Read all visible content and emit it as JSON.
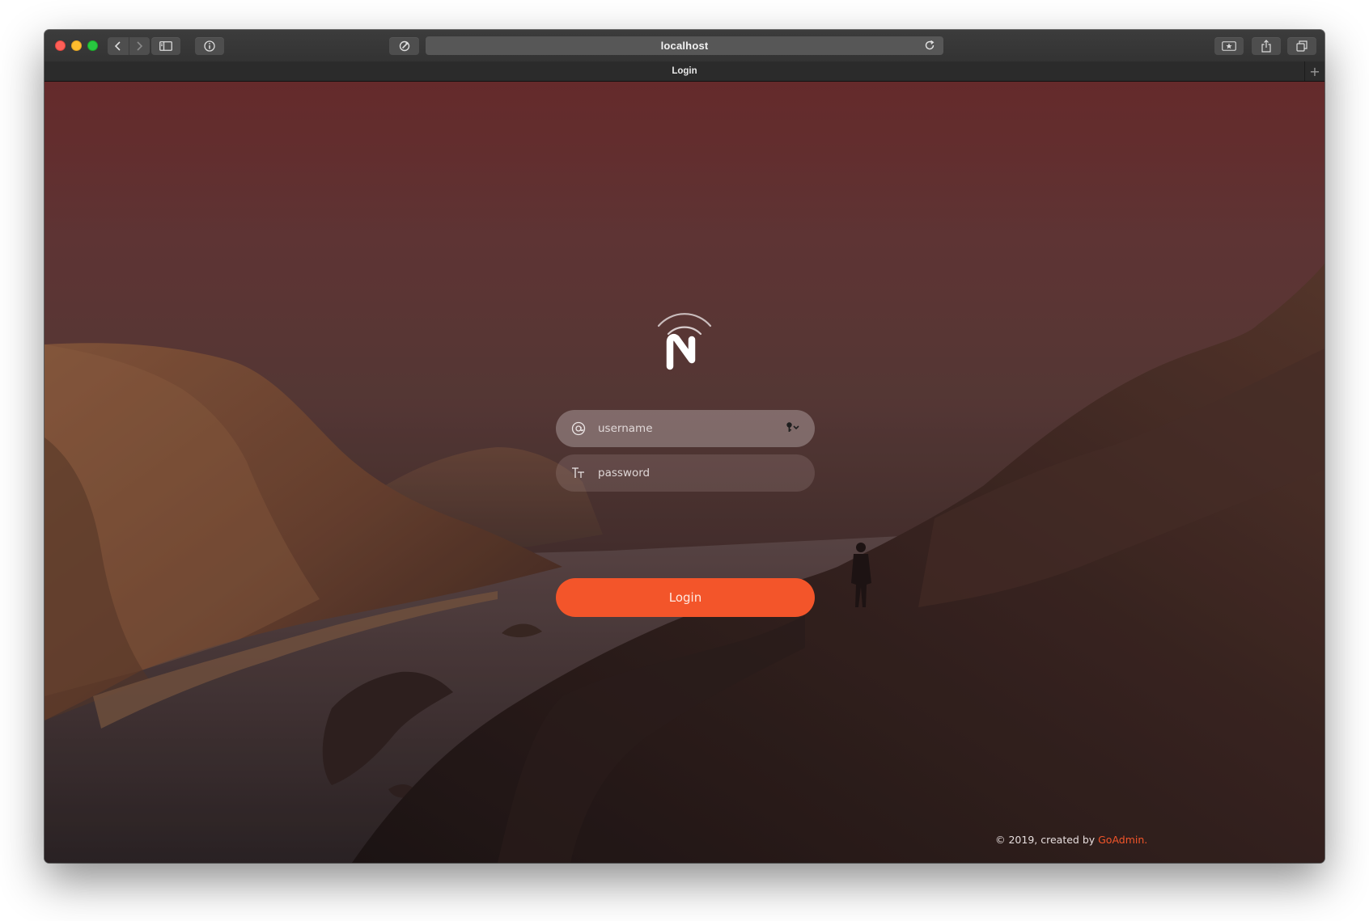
{
  "browser": {
    "url": "localhost",
    "tab_title": "Login",
    "new_tab_label": "+"
  },
  "login": {
    "username_placeholder": "username",
    "password_placeholder": "password",
    "button_label": "Login"
  },
  "footer": {
    "prefix": "© 2019, created by ",
    "link_text": "GoAdmin",
    "suffix": "."
  },
  "colors": {
    "accent": "#f3552a",
    "toolbar": "#383838",
    "tabbar": "#2b2b2b"
  },
  "icons": {
    "username_field": "at-sign-icon",
    "password_field": "text-size-icon",
    "autofill": "keychain-icon",
    "reload": "reload-icon",
    "logo": "n-signal-logo"
  }
}
